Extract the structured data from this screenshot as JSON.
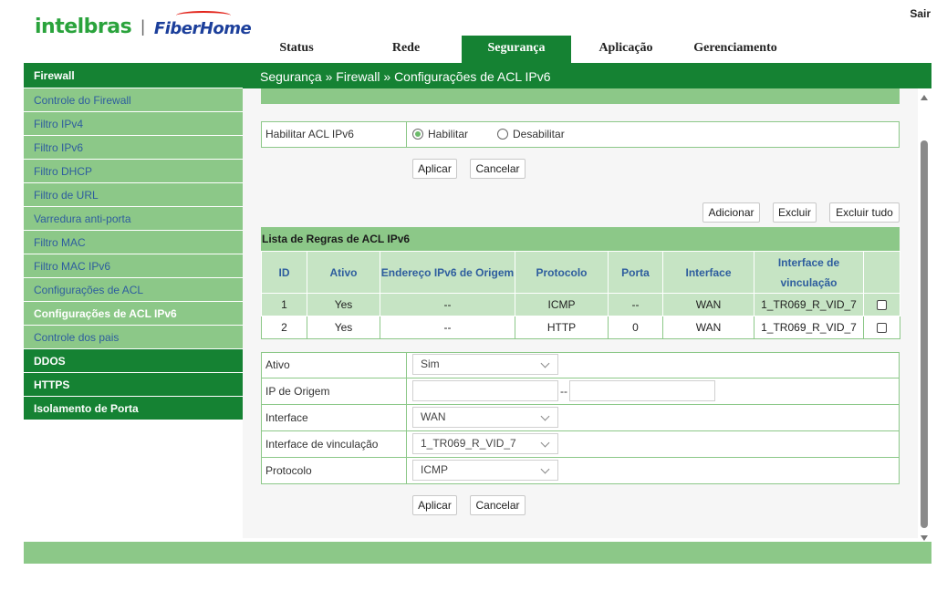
{
  "header": {
    "logo_brand": "intelbras",
    "logo_separator": "|",
    "logo_partner": "FiberHome",
    "logout": "Sair"
  },
  "topnav": [
    {
      "label": "Status",
      "active": false
    },
    {
      "label": "Rede",
      "active": false
    },
    {
      "label": "Segurança",
      "active": true
    },
    {
      "label": "Aplicação",
      "active": false
    },
    {
      "label": "Gerenciamento",
      "active": false
    }
  ],
  "breadcrumb": "Segurança » Firewall » Configurações de ACL IPv6",
  "sidebar": {
    "section_firewall": "Firewall",
    "items": [
      "Controle do Firewall",
      "Filtro IPv4",
      "Filtro IPv6",
      "Filtro DHCP",
      "Filtro de URL",
      "Varredura anti-porta",
      "Filtro MAC",
      "Filtro MAC IPv6",
      "Configurações de ACL",
      "Configurações de ACL IPv6",
      "Controle dos pais"
    ],
    "active_item": "Configurações de ACL IPv6",
    "sections": [
      "DDOS",
      "HTTPS",
      "Isolamento de Porta"
    ]
  },
  "enable_form": {
    "label": "Habilitar ACL IPv6",
    "option_enable": "Habilitar",
    "option_disable": "Desabilitar",
    "selected": "Habilitar",
    "apply": "Aplicar",
    "cancel": "Cancelar"
  },
  "actions": {
    "add": "Adicionar",
    "delete": "Excluir",
    "delete_all": "Excluir tudo"
  },
  "rules_table": {
    "caption": "Lista de Regras de ACL IPv6",
    "columns": [
      "ID",
      "Ativo",
      "Endereço IPv6 de Origem",
      "Protocolo",
      "Porta",
      "Interface",
      "Interface de vinculação",
      ""
    ],
    "rows": [
      {
        "id": "1",
        "ativo": "Yes",
        "origem": "--",
        "protocolo": "ICMP",
        "porta": "--",
        "interface": "WAN",
        "vinculacao": "1_TR069_R_VID_7",
        "checked": false
      },
      {
        "id": "2",
        "ativo": "Yes",
        "origem": "--",
        "protocolo": "HTTP",
        "porta": "0",
        "interface": "WAN",
        "vinculacao": "1_TR069_R_VID_7",
        "checked": false
      }
    ]
  },
  "rule_form": {
    "ativo_label": "Ativo",
    "ativo_value": "Sim",
    "ip_label": "IP de Origem",
    "ip_start": "",
    "ip_separator": "--",
    "ip_end": "",
    "interface_label": "Interface",
    "interface_value": "WAN",
    "vinculacao_label": "Interface de vinculação",
    "vinculacao_value": "1_TR069_R_VID_7",
    "protocolo_label": "Protocolo",
    "protocolo_value": "ICMP",
    "apply": "Aplicar",
    "cancel": "Cancelar"
  },
  "colors": {
    "dark_green": "#158233",
    "light_green": "#8cc888",
    "header_cell": "#c6e4c4",
    "link_blue": "#2e5d9e"
  }
}
